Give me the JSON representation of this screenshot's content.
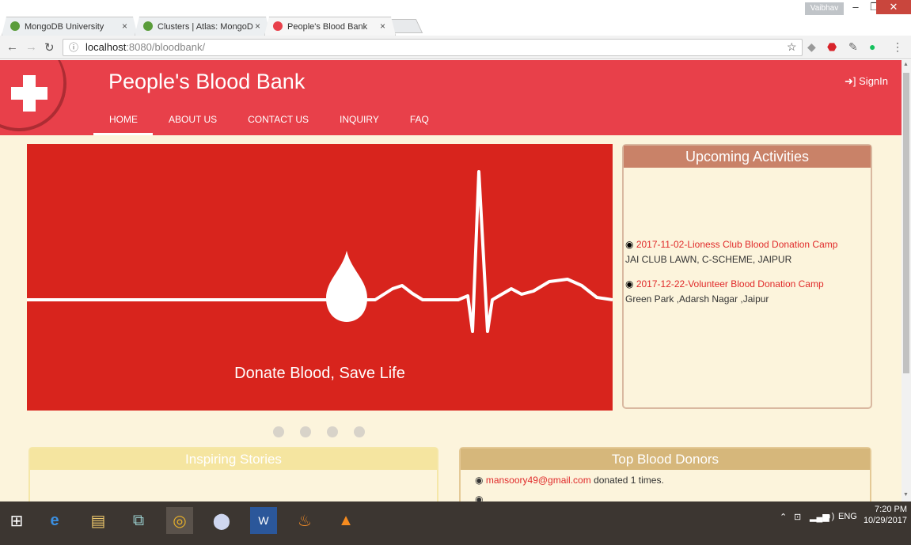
{
  "browser": {
    "tabs": [
      {
        "label": "MongoDB University",
        "favicon_color": "#5a9c3a"
      },
      {
        "label": "Clusters | Atlas: MongoD",
        "favicon_color": "#5a9c3a"
      },
      {
        "label": "People's Blood Bank",
        "favicon_color": "#e8404a"
      }
    ],
    "window_user": "Vaibhav",
    "url_host": "localhost",
    "url_path": ":8080/bloodbank/"
  },
  "site": {
    "title": "People's Blood Bank",
    "signin": "SignIn",
    "menu": [
      "HOME",
      "ABOUT US",
      "CONTACT US",
      "INQUIRY",
      "FAQ"
    ],
    "active_menu": "HOME",
    "accent": "#e8404a"
  },
  "carousel": {
    "caption": "Donate Blood, Save Life",
    "slide_count": 4
  },
  "activities": {
    "heading": "Upcoming Activities",
    "items": [
      {
        "title": "2017-11-02-Lioness Club Blood Donation Camp",
        "address": "JAI CLUB LAWN, C-SCHEME, JAIPUR"
      },
      {
        "title": "2017-12-22-Volunteer Blood Donation Camp",
        "address": "Green Park ,Adarsh Nagar ,Jaipur"
      }
    ]
  },
  "stories": {
    "heading": "Inspiring Stories"
  },
  "donors": {
    "heading": "Top Blood Donors",
    "items": [
      {
        "email": "mansoory49@gmail.com",
        "text": "donated 1 times."
      }
    ]
  },
  "taskbar": {
    "tray_lang": "ENG",
    "time": "7:20 PM",
    "date": "10/29/2017"
  }
}
